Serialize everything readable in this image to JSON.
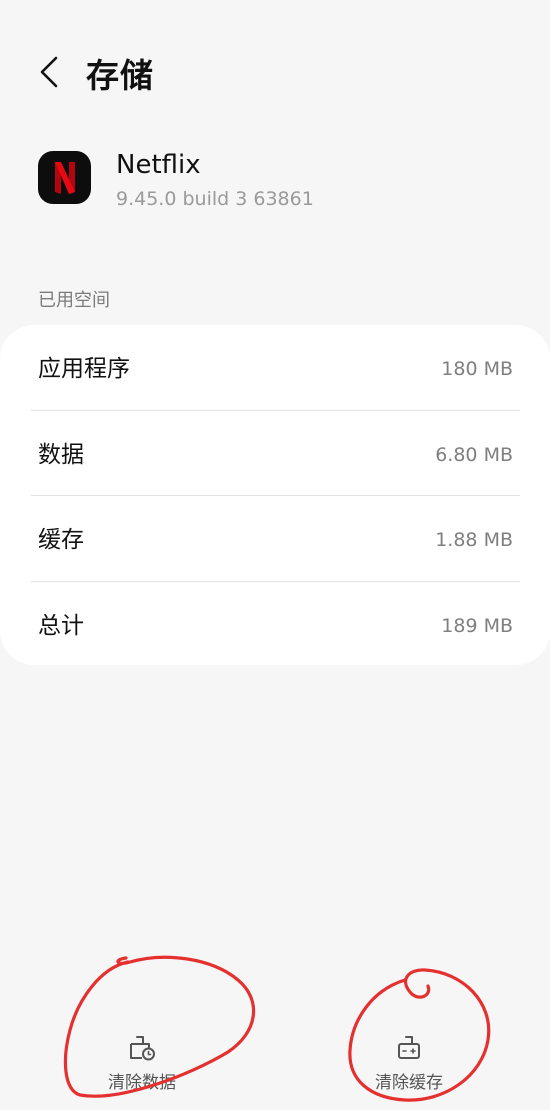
{
  "header": {
    "title": "存储",
    "back_icon": "chevron-left-icon"
  },
  "app": {
    "name": "Netflix",
    "version": "9.45.0 build 3 63861",
    "icon_letter": "N",
    "icon_color": "#E50914"
  },
  "storage": {
    "section_label": "已用空间",
    "rows": [
      {
        "label": "应用程序",
        "value": "180 MB"
      },
      {
        "label": "数据",
        "value": "6.80 MB"
      },
      {
        "label": "缓存",
        "value": "1.88 MB"
      },
      {
        "label": "总计",
        "value": "189 MB"
      }
    ]
  },
  "actions": {
    "clear_data": {
      "label": "清除数据",
      "icon": "broom-clear-data-icon"
    },
    "clear_cache": {
      "label": "清除缓存",
      "icon": "broom-clear-cache-icon"
    }
  },
  "colors": {
    "background": "#f6f6f6",
    "card": "#ffffff",
    "annotation_red": "#e53030"
  }
}
